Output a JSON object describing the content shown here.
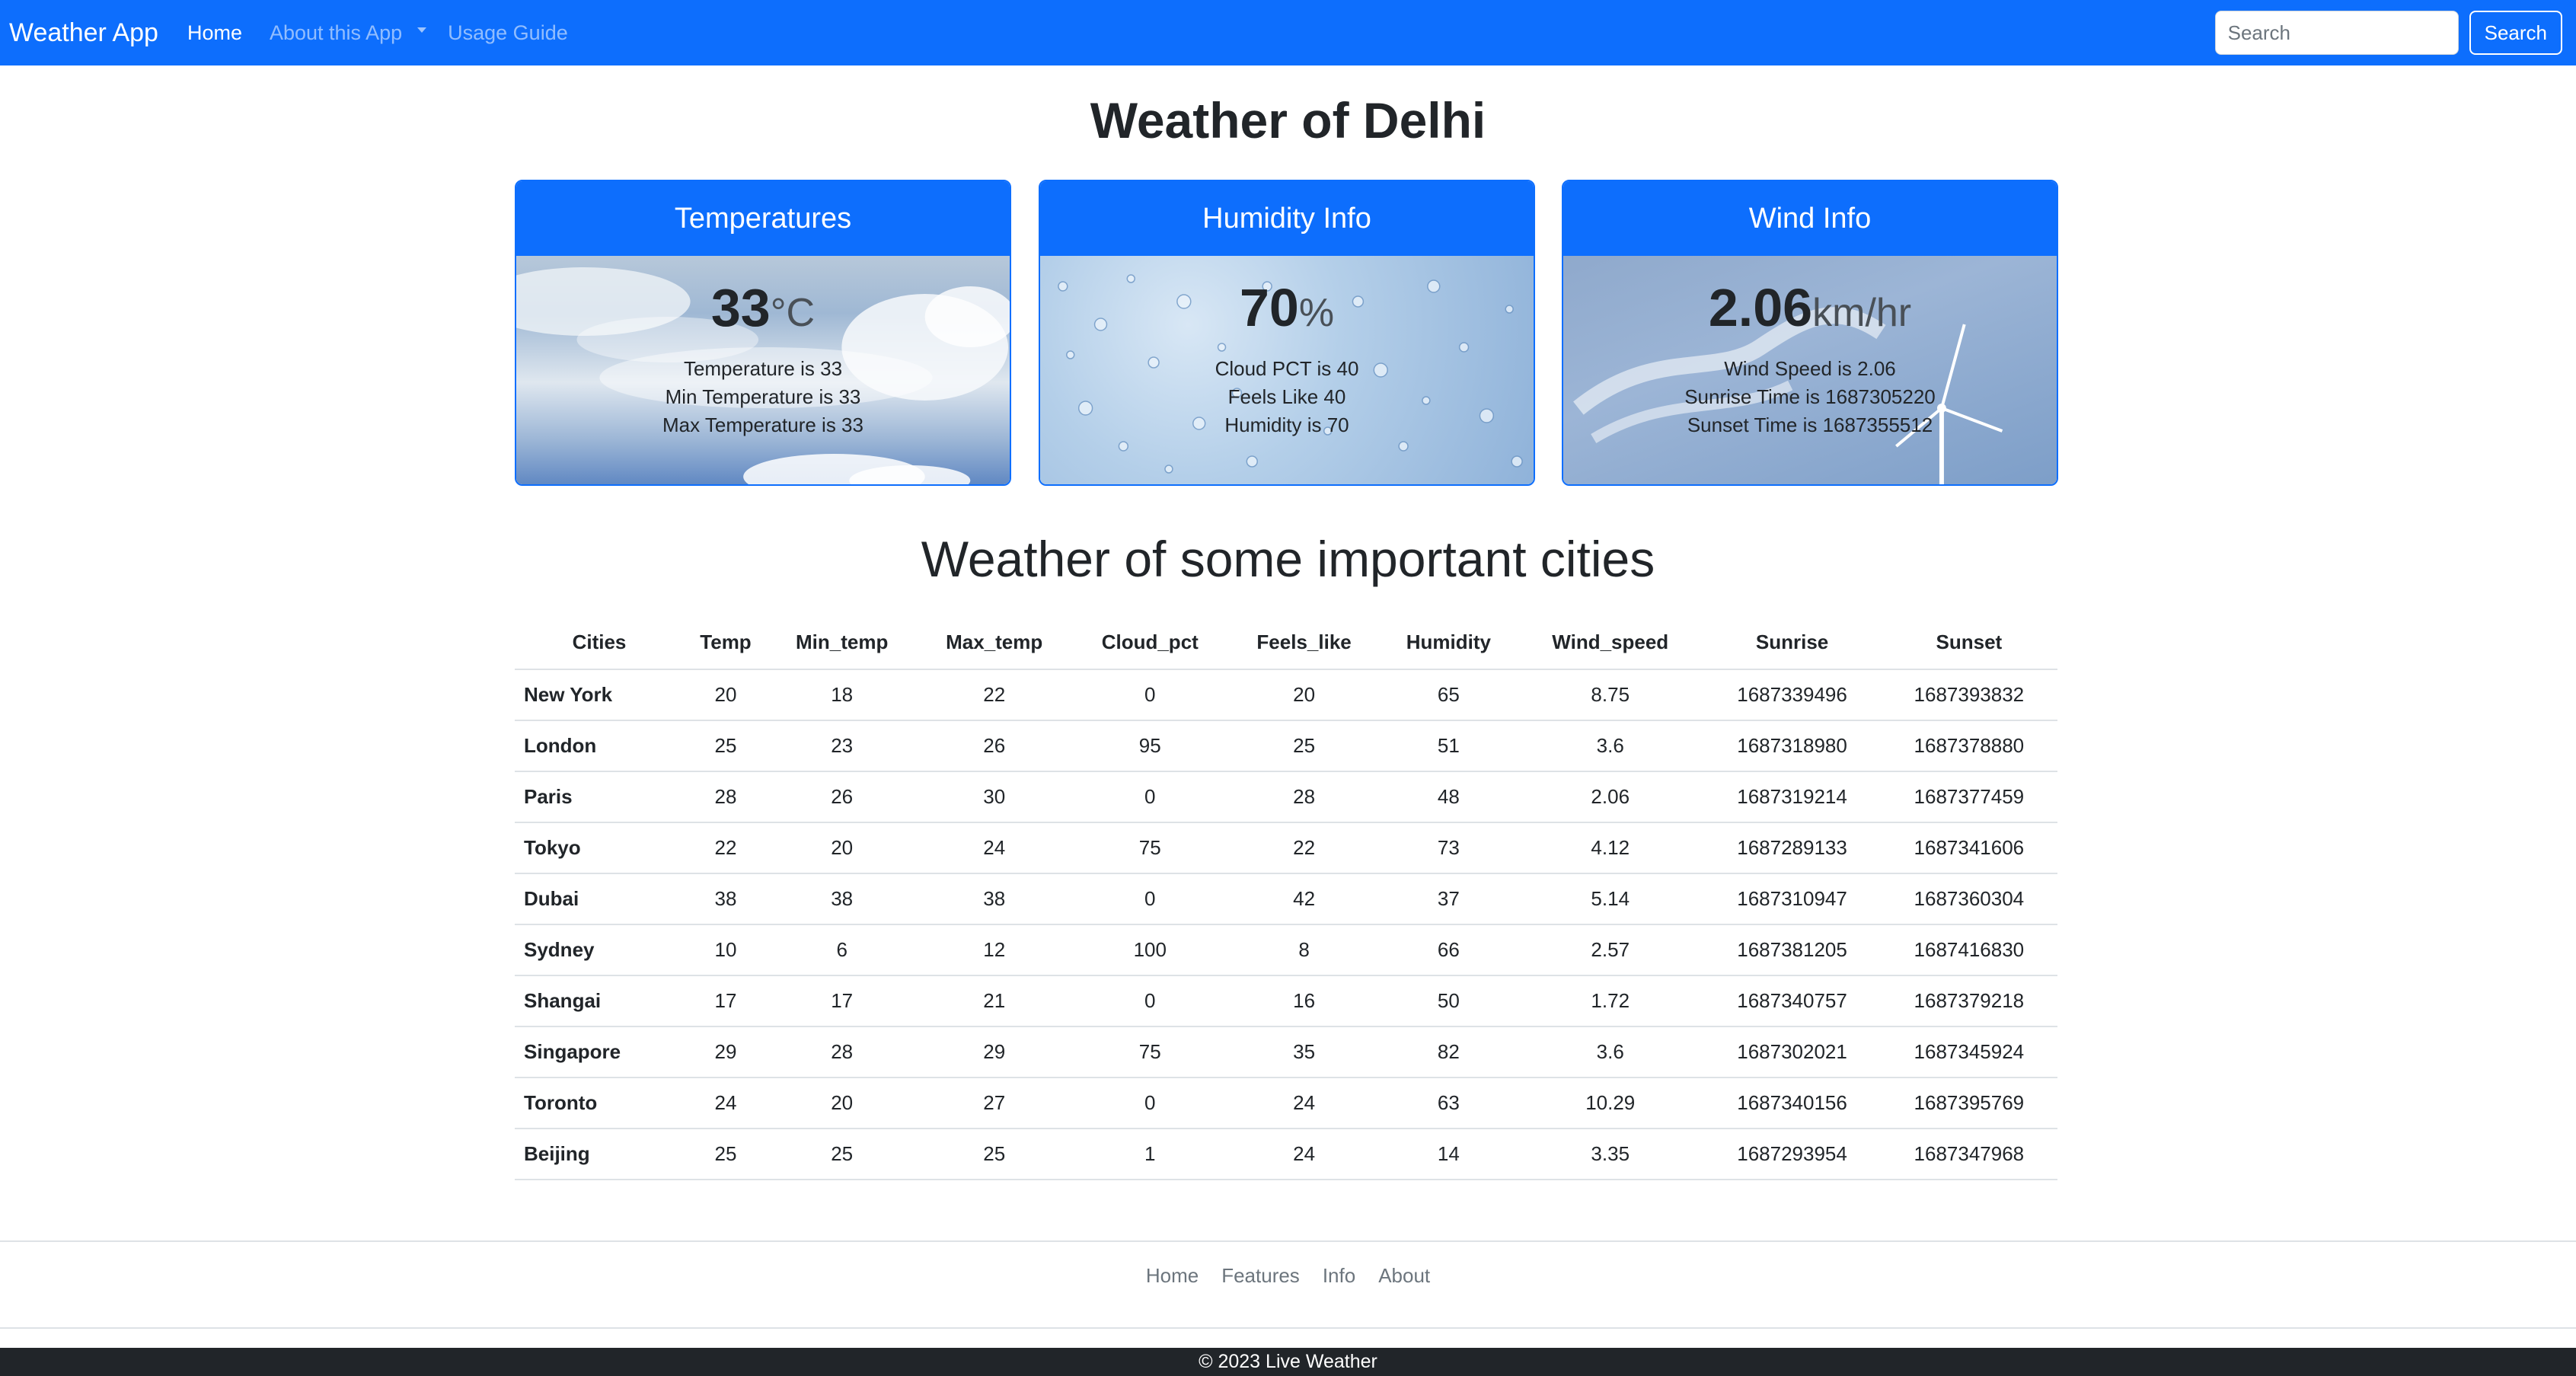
{
  "navbar": {
    "brand": "Weather App",
    "links": [
      "Home",
      "About this App",
      "Usage Guide"
    ],
    "search_placeholder": "Search",
    "search_button": "Search"
  },
  "title": "Weather of Delhi",
  "cards": {
    "temperature": {
      "header": "Temperatures",
      "value": "33",
      "unit": "°C",
      "lines": [
        "Temperature is 33",
        "Min Temperature is 33",
        "Max Temperature is 33"
      ]
    },
    "humidity": {
      "header": "Humidity Info",
      "value": "70",
      "unit": "%",
      "lines": [
        "Cloud PCT is 40",
        "Feels Like 40",
        "Humidity is 70"
      ]
    },
    "wind": {
      "header": "Wind Info",
      "value": "2.06",
      "unit": "km/hr",
      "lines": [
        "Wind Speed is 2.06",
        "Sunrise Time is 1687305220",
        "Sunset Time is 1687355512"
      ]
    }
  },
  "section_title": "Weather of some important cities",
  "table": {
    "headers": [
      "Cities",
      "Temp",
      "Min_temp",
      "Max_temp",
      "Cloud_pct",
      "Feels_like",
      "Humidity",
      "Wind_speed",
      "Sunrise",
      "Sunset"
    ],
    "rows": [
      [
        "New York",
        "20",
        "18",
        "22",
        "0",
        "20",
        "65",
        "8.75",
        "1687339496",
        "1687393832"
      ],
      [
        "London",
        "25",
        "23",
        "26",
        "95",
        "25",
        "51",
        "3.6",
        "1687318980",
        "1687378880"
      ],
      [
        "Paris",
        "28",
        "26",
        "30",
        "0",
        "28",
        "48",
        "2.06",
        "1687319214",
        "1687377459"
      ],
      [
        "Tokyo",
        "22",
        "20",
        "24",
        "75",
        "22",
        "73",
        "4.12",
        "1687289133",
        "1687341606"
      ],
      [
        "Dubai",
        "38",
        "38",
        "38",
        "0",
        "42",
        "37",
        "5.14",
        "1687310947",
        "1687360304"
      ],
      [
        "Sydney",
        "10",
        "6",
        "12",
        "100",
        "8",
        "66",
        "2.57",
        "1687381205",
        "1687416830"
      ],
      [
        "Shangai",
        "17",
        "17",
        "21",
        "0",
        "16",
        "50",
        "1.72",
        "1687340757",
        "1687379218"
      ],
      [
        "Singapore",
        "29",
        "28",
        "29",
        "75",
        "35",
        "82",
        "3.6",
        "1687302021",
        "1687345924"
      ],
      [
        "Toronto",
        "24",
        "20",
        "27",
        "0",
        "24",
        "63",
        "10.29",
        "1687340156",
        "1687395769"
      ],
      [
        "Beijing",
        "25",
        "25",
        "25",
        "1",
        "24",
        "14",
        "3.35",
        "1687293954",
        "1687347968"
      ]
    ]
  },
  "footer": {
    "links": [
      "Home",
      "Features",
      "Info",
      "About"
    ],
    "copyright": "© 2023 Live Weather"
  },
  "colors": {
    "primary": "#0d6efd",
    "dark": "#212529"
  }
}
